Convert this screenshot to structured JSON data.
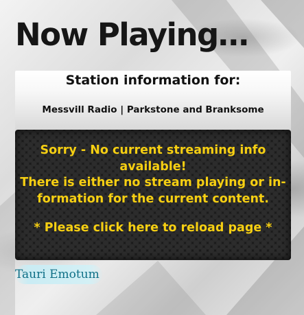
{
  "page": {
    "title": "Now Playing…"
  },
  "station": {
    "heading": "Station information for:",
    "name": "Messvill Radio | Parkstone and Branksome"
  },
  "message": {
    "line1": "Sorry - No current streaming info available!",
    "line2": "There is either no stream playing or in­formation for the current content.",
    "reload": "* Please click here to reload page *",
    "color": "#f6cf12"
  },
  "footer": {
    "brand": "Tauri Emotum"
  }
}
